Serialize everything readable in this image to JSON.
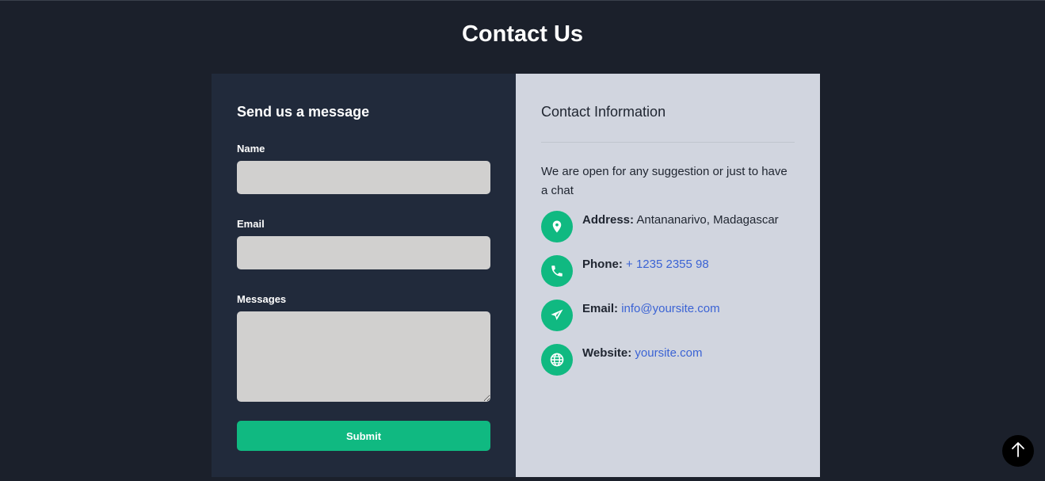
{
  "page": {
    "title": "Contact Us"
  },
  "form": {
    "heading": "Send us a message",
    "name_label": "Name",
    "name_value": "",
    "email_label": "Email",
    "email_value": "",
    "message_label": "Messages",
    "message_value": "",
    "submit_label": "Submit"
  },
  "info": {
    "heading": "Contact Information",
    "intro": "We are open for any suggestion or just to have a chat",
    "items": [
      {
        "icon": "map-pin-icon",
        "key": "Address:",
        "value": "Antananarivo, Madagascar",
        "is_link": false
      },
      {
        "icon": "phone-icon",
        "key": "Phone:",
        "value": "+ 1235 2355 98",
        "is_link": true
      },
      {
        "icon": "paper-plane-icon",
        "key": "Email:",
        "value": "info@yoursite.com",
        "is_link": true
      },
      {
        "icon": "globe-icon",
        "key": "Website:",
        "value": "yoursite.com",
        "is_link": true
      }
    ]
  },
  "colors": {
    "background": "#1b202b",
    "form_panel": "#212a3b",
    "info_panel": "#d1d5df",
    "accent": "#10b981",
    "link": "#3b63d4",
    "input": "#d1d0cf"
  },
  "scroll_top": {
    "icon": "arrow-up-icon"
  }
}
